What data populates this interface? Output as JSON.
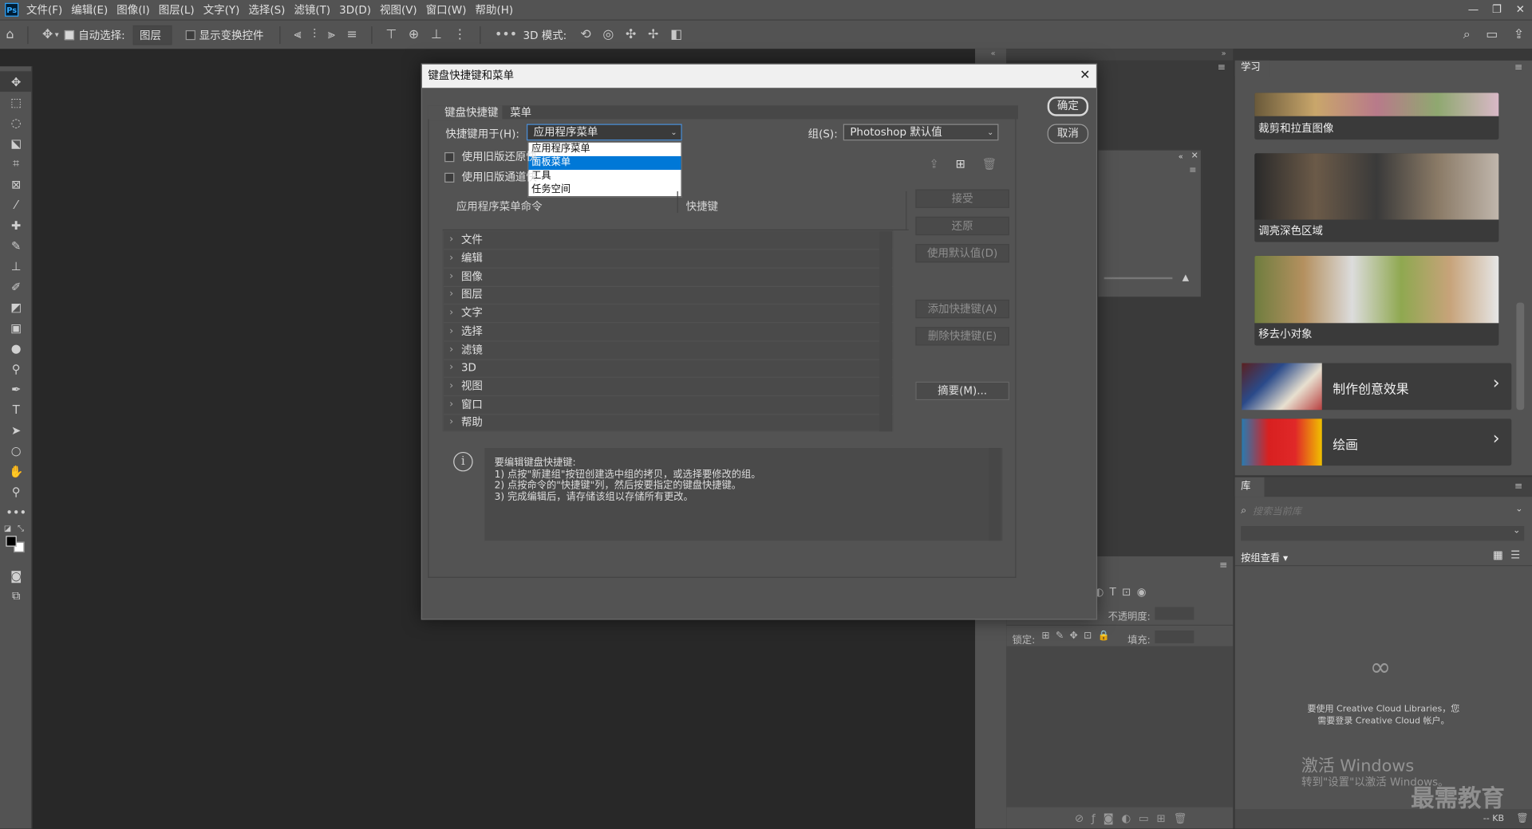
{
  "menubar": {
    "items": [
      "文件(F)",
      "编辑(E)",
      "图像(I)",
      "图层(L)",
      "文字(Y)",
      "选择(S)",
      "滤镜(T)",
      "3D(D)",
      "视图(V)",
      "窗口(W)",
      "帮助(H)"
    ],
    "window_controls": [
      "—",
      "❐",
      "✕"
    ]
  },
  "optionsbar": {
    "auto_select_label": "自动选择:",
    "auto_select_value": "图层",
    "show_transform_label": "显示变换控件",
    "mode3d_label": "3D 模式:"
  },
  "dialog": {
    "title": "键盘快捷键和菜单",
    "ok_label": "确定",
    "cancel_label": "取消",
    "tabs": [
      "键盘快捷键",
      "菜单"
    ],
    "shortcuts_for_label": "快捷键用于(H):",
    "shortcuts_for_value": "应用程序菜单",
    "group_label": "组(S):",
    "group_value": "Photoshop 默认值",
    "dropdown_options": [
      "应用程序菜单",
      "面板菜单",
      "工具",
      "任务空间"
    ],
    "dropdown_selected": "面板菜单",
    "legacy_undo_label": "使用旧版还原快",
    "legacy_channel_label": "使用旧版通道快",
    "col_command": "应用程序菜单命令",
    "col_shortcut": "快捷键",
    "tree_items": [
      "文件",
      "编辑",
      "图像",
      "图层",
      "文字",
      "选择",
      "滤镜",
      "3D",
      "视图",
      "窗口",
      "帮助"
    ],
    "side_buttons": {
      "accept": "接受",
      "undo": "还原",
      "use_default": "使用默认值(D)",
      "add_shortcut": "添加快捷键(A)",
      "delete_shortcut": "删除快捷键(E)",
      "summarize": "摘要(M)..."
    },
    "info_lines": [
      "要编辑键盘快捷键:",
      "1) 点按\"新建组\"按钮创建选中组的拷贝，或选择要修改的组。",
      "2) 点按命令的\"快捷键\"列，然后按要指定的键盘快捷键。",
      "3) 完成编辑后，请存储该组以存储所有更改。"
    ]
  },
  "learn": {
    "tab": "学习",
    "cards": [
      "裁剪和拉直图像",
      "调亮深色区域",
      "移去小对象"
    ],
    "big_cards": [
      "制作创意效果",
      "绘画"
    ]
  },
  "libraries": {
    "tab": "库",
    "search_placeholder": "搜索当前库",
    "view_by": "按组查看",
    "cc_message_1": "要使用 Creative Cloud Libraries，您",
    "cc_message_2": "需要登录 Creative Cloud 帐户。",
    "size": "-- KB"
  },
  "layers": {
    "opacity_label": "不透明度:",
    "lock_label": "锁定:",
    "fill_label": "填充:"
  },
  "watermark": {
    "line1": "激活 Windows",
    "line2": "转到\"设置\"以激活 Windows。",
    "brand": "最需教育"
  }
}
